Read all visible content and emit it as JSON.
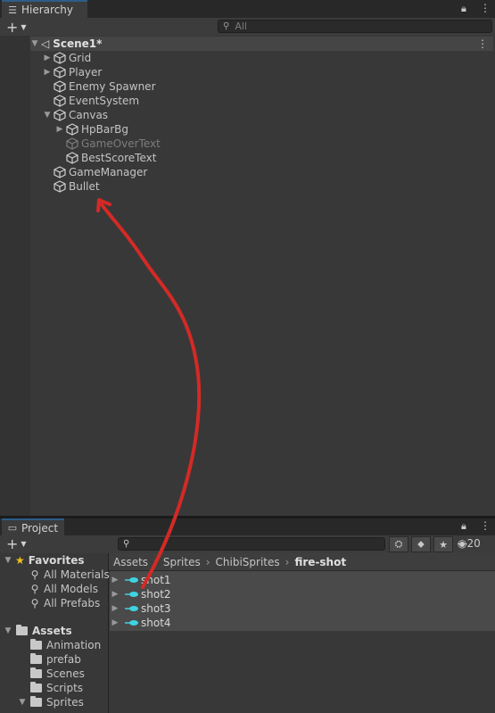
{
  "hierarchy": {
    "tab_label": "Hierarchy",
    "search_placeholder": "All",
    "scene": "Scene1*",
    "items": [
      {
        "label": "Grid",
        "depth": 1,
        "arrow": "right",
        "dim": false
      },
      {
        "label": "Player",
        "depth": 1,
        "arrow": "right",
        "dim": false
      },
      {
        "label": "Enemy Spawner",
        "depth": 1,
        "arrow": "",
        "dim": false
      },
      {
        "label": "EventSystem",
        "depth": 1,
        "arrow": "",
        "dim": false
      },
      {
        "label": "Canvas",
        "depth": 1,
        "arrow": "down",
        "dim": false
      },
      {
        "label": "HpBarBg",
        "depth": 2,
        "arrow": "right",
        "dim": false
      },
      {
        "label": "GameOverText",
        "depth": 2,
        "arrow": "",
        "dim": true
      },
      {
        "label": "BestScoreText",
        "depth": 2,
        "arrow": "",
        "dim": false
      },
      {
        "label": "GameManager",
        "depth": 1,
        "arrow": "",
        "dim": false
      },
      {
        "label": "Bullet",
        "depth": 1,
        "arrow": "",
        "dim": false
      }
    ]
  },
  "project": {
    "tab_label": "Project",
    "hidden_count": "20",
    "favorites_label": "Favorites",
    "favorites": [
      "All Materials",
      "All Models",
      "All Prefabs"
    ],
    "assets_label": "Assets",
    "folders": [
      "Animation",
      "prefab",
      "Scenes",
      "Scripts",
      "Sprites"
    ],
    "breadcrumb": [
      "Assets",
      "Sprites",
      "ChibiSprites",
      "fire-shot"
    ],
    "files": [
      "shot1",
      "shot2",
      "shot3",
      "shot4"
    ]
  },
  "colors": {
    "annotation_arrow": "#d32a26",
    "tab_accent": "#2c5d87",
    "sprite_cyan": "#3fd3e0"
  }
}
